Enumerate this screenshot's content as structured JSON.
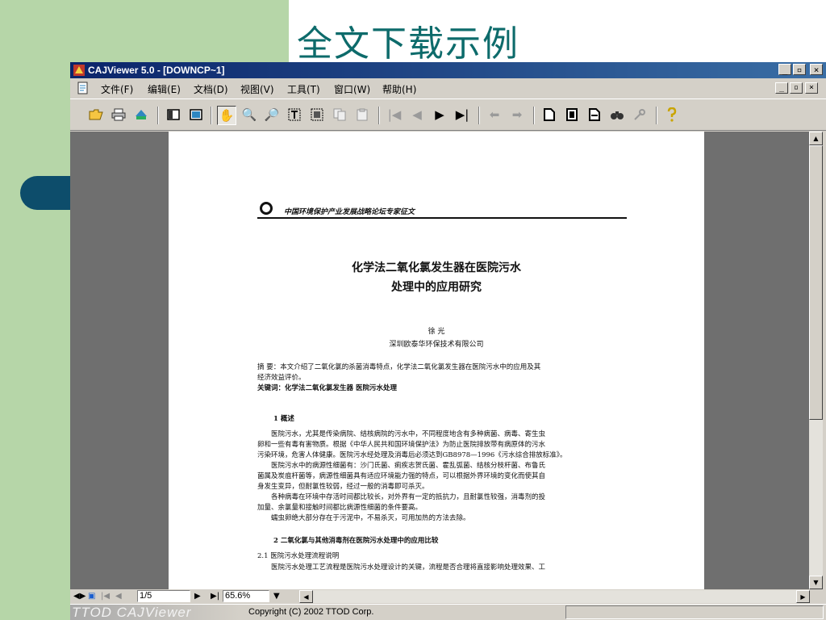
{
  "slide": {
    "title": "全文下载示例"
  },
  "window": {
    "title": "CAJViewer 5.0 - [DOWNCP~1]",
    "min": "_",
    "max": "▫",
    "close": "×"
  },
  "menu": {
    "items": [
      "文件(F)",
      "编辑(E)",
      "文档(D)",
      "视图(V)",
      "工具(T)",
      "窗口(W)",
      "帮助(H)"
    ]
  },
  "document": {
    "header": "中国环境保护产业发展战略论坛专家征文",
    "title_line1": "化学法二氧化氯发生器在医院污水",
    "title_line2": "处理中的应用研究",
    "author": "徐 光",
    "affiliation": "深圳欧泰华环保技术有限公司",
    "abstract_line1": "摘 要：本文介绍了二氧化氯的杀菌消毒特点，化学法二氧化氯发生器在医院污水中的应用及其",
    "abstract_line2": "经济效益评价。",
    "keywords": "关键词：化学法二氧化氯发生器 医院污水处理",
    "section1": "1 概述",
    "p1_l1": "医院污水，尤其是传染病院、结核病院的污水中，不同程度地含有多种病菌、病毒、寄生虫",
    "p1_l2": "卵和一些有毒有害物质。根据《中华人民共和国环境保护法》为防止医院排放带有病原体的污水",
    "p1_l3": "污染环境，危害人体健康。医院污水经处理及消毒后必须达到GB8978—1996《污水综合排放标准》。",
    "p2_l1": "医院污水中的病源性细菌有：沙门氏菌、痢疾志贺氏菌、霍乱弧菌、结核分枝杆菌、布鲁氏",
    "p2_l2": "菌属及炭疽杆菌等，病源性细菌具有适应环境能力强的特点，可以根据外界环境的变化而使其自",
    "p2_l3": "身发生变异，但耐氯性较弱，经过一般的消毒即可杀灭。",
    "p3_l1": "各种病毒在环境中存活时间都比较长，对外界有一定的抵抗力，且耐氯性较强，消毒剂的投",
    "p3_l2": "加量、余氯量和接触时间都比病源性细菌的条件要高。",
    "p4_l1": "蠕虫卵绝大部分存在于污泥中，不易杀灭，可用加热的方法去除。",
    "section2": "2 二氧化氯与其他消毒剂在医院污水处理中的应用比较",
    "section21": "2.1 医院污水处理流程说明",
    "p5_l1": "医院污水处理工艺流程是医院污水处理设计的关键，流程是否合理将直接影响处理效果、工"
  },
  "nav": {
    "page": "1/5",
    "zoom": "65.6%"
  },
  "status": {
    "brand": "TTOD CAJViewer",
    "copyright": "Copyright (C) 2002 TTOD Corp."
  },
  "colors": {
    "slide_bg": "#b6d6a8",
    "title": "#0d6b6b",
    "titlebar": "#0a246a",
    "viewport": "#6f6f6f"
  }
}
